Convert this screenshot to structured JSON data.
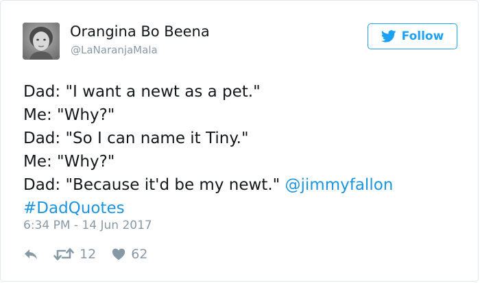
{
  "author": {
    "display_name": "Orangina Bo Beena",
    "handle": "@LaNaranjaMala",
    "avatar_icon": "vintage-child-photo"
  },
  "follow_button": {
    "label": "Follow",
    "icon": "twitter-bird-icon",
    "color": "#1da1f2"
  },
  "tweet": {
    "lines": [
      "Dad: \"I want a newt as a pet.\"",
      "Me: \"Why?\"",
      "Dad: \"So I can name it Tiny.\"",
      "Me: \"Why?\"",
      "Dad: \"Because it'd be my newt.\""
    ],
    "mention": "@jimmyfallon",
    "hashtag": "#DadQuotes",
    "link_color": "#1b95e0"
  },
  "timestamp": "6:34 PM - 14 Jun 2017",
  "actions": {
    "reply_icon": "reply-icon",
    "retweet_icon": "retweet-icon",
    "retweet_count": "12",
    "like_icon": "heart-icon",
    "like_count": "62"
  }
}
